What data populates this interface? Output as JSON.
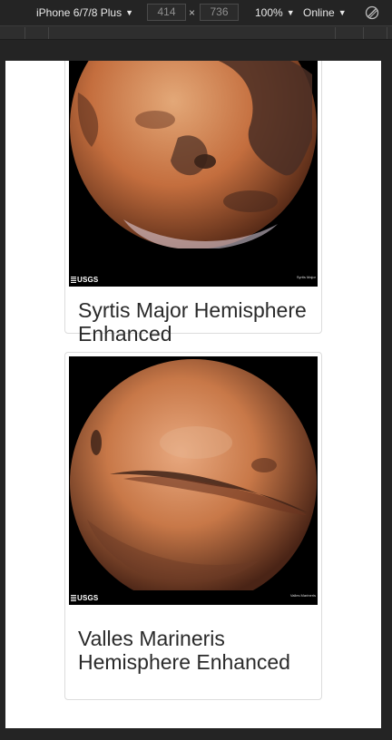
{
  "devtools": {
    "device": "iPhone 6/7/8 Plus",
    "width": "414",
    "times": "×",
    "height": "736",
    "zoom": "100%",
    "network": "Online"
  },
  "cards": [
    {
      "title": "Syrtis Major Hemisphere Enhanced",
      "logo_text": "USGS",
      "image_caption": "Syrtis Major"
    },
    {
      "title": "Valles Marineris Hemisphere Enhanced",
      "logo_text": "USGS",
      "image_caption": "Valles Marineris"
    }
  ],
  "colors": {
    "devtools_bg": "#242424",
    "page_bg": "#ffffff",
    "card_border": "#dcdcdc",
    "title_text": "#2a2a2a",
    "mars_light": "#e09a6a",
    "mars_mid": "#c46e3e",
    "mars_dark": "#4a2a1e"
  }
}
